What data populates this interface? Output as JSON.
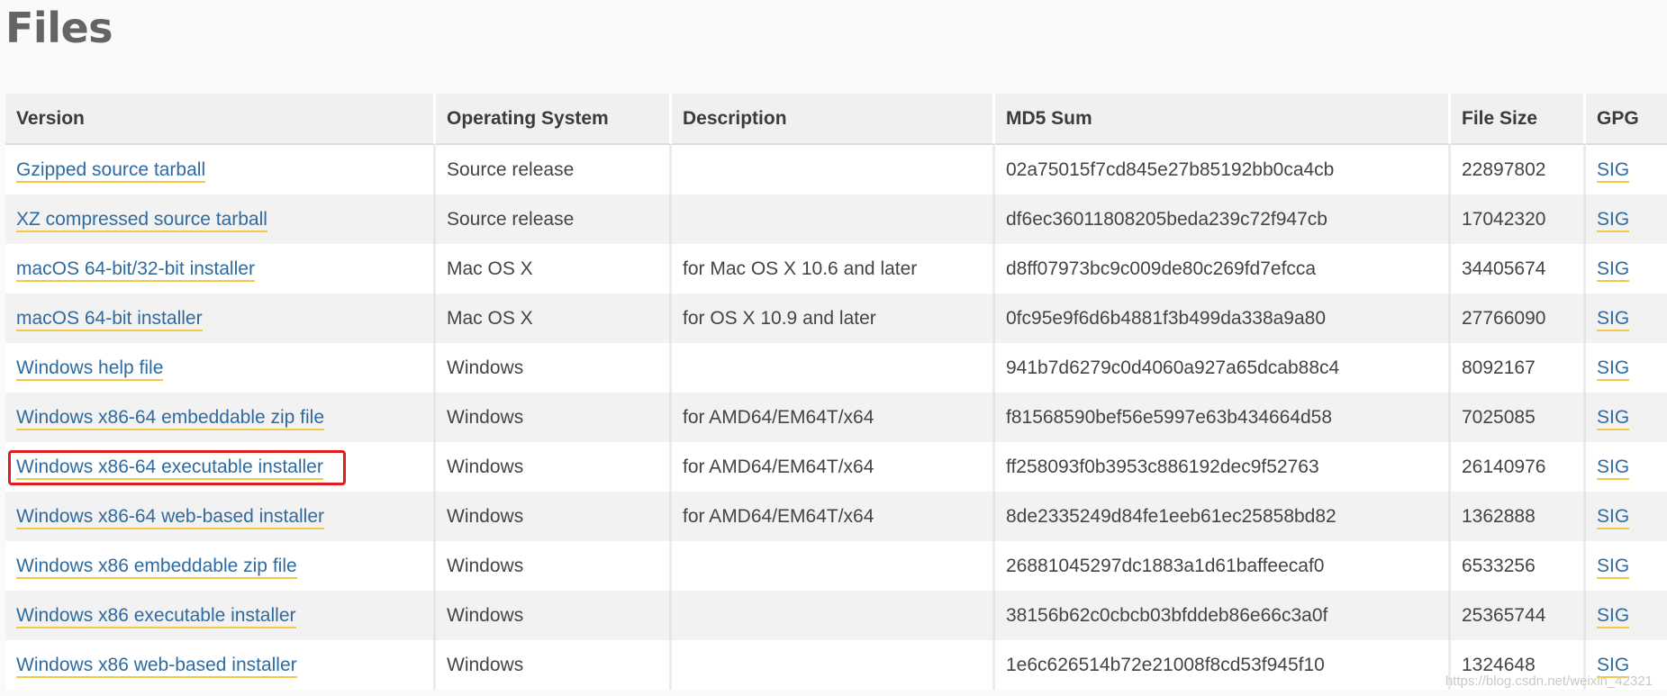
{
  "page": {
    "heading": "Files"
  },
  "table": {
    "headers": {
      "version": "Version",
      "os": "Operating System",
      "description": "Description",
      "md5": "MD5 Sum",
      "size": "File Size",
      "gpg": "GPG"
    },
    "rows": [
      {
        "version": "Gzipped source tarball",
        "os": "Source release",
        "description": "",
        "md5": "02a75015f7cd845e27b85192bb0ca4cb",
        "size": "22897802",
        "gpg": "SIG"
      },
      {
        "version": "XZ compressed source tarball",
        "os": "Source release",
        "description": "",
        "md5": "df6ec36011808205beda239c72f947cb",
        "size": "17042320",
        "gpg": "SIG"
      },
      {
        "version": "macOS 64-bit/32-bit installer",
        "os": "Mac OS X",
        "description": "for Mac OS X 10.6 and later",
        "md5": "d8ff07973bc9c009de80c269fd7efcca",
        "size": "34405674",
        "gpg": "SIG"
      },
      {
        "version": "macOS 64-bit installer",
        "os": "Mac OS X",
        "description": "for OS X 10.9 and later",
        "md5": "0fc95e9f6d6b4881f3b499da338a9a80",
        "size": "27766090",
        "gpg": "SIG"
      },
      {
        "version": "Windows help file",
        "os": "Windows",
        "description": "",
        "md5": "941b7d6279c0d4060a927a65dcab88c4",
        "size": "8092167",
        "gpg": "SIG"
      },
      {
        "version": "Windows x86-64 embeddable zip file",
        "os": "Windows",
        "description": "for AMD64/EM64T/x64",
        "md5": "f81568590bef56e5997e63b434664d58",
        "size": "7025085",
        "gpg": "SIG"
      },
      {
        "version": "Windows x86-64 executable installer",
        "os": "Windows",
        "description": "for AMD64/EM64T/x64",
        "md5": "ff258093f0b3953c886192dec9f52763",
        "size": "26140976",
        "gpg": "SIG"
      },
      {
        "version": "Windows x86-64 web-based installer",
        "os": "Windows",
        "description": "for AMD64/EM64T/x64",
        "md5": "8de2335249d84fe1eeb61ec25858bd82",
        "size": "1362888",
        "gpg": "SIG"
      },
      {
        "version": "Windows x86 embeddable zip file",
        "os": "Windows",
        "description": "",
        "md5": "26881045297dc1883a1d61baffeecaf0",
        "size": "6533256",
        "gpg": "SIG"
      },
      {
        "version": "Windows x86 executable installer",
        "os": "Windows",
        "description": "",
        "md5": "38156b62c0cbcb03bfddeb86e66c3a0f",
        "size": "25365744",
        "gpg": "SIG"
      },
      {
        "version": "Windows x86 web-based installer",
        "os": "Windows",
        "description": "",
        "md5": "1e6c626514b72e21008f8cd53f945f10",
        "size": "1324648",
        "gpg": "SIG"
      }
    ]
  },
  "colors": {
    "link": "#2f6aa0",
    "link_underline": "#f3c84a",
    "highlight_border": "#e01d1d",
    "header_bg": "#f0f0f0"
  },
  "watermark": "https://blog.csdn.net/weixin_42321"
}
